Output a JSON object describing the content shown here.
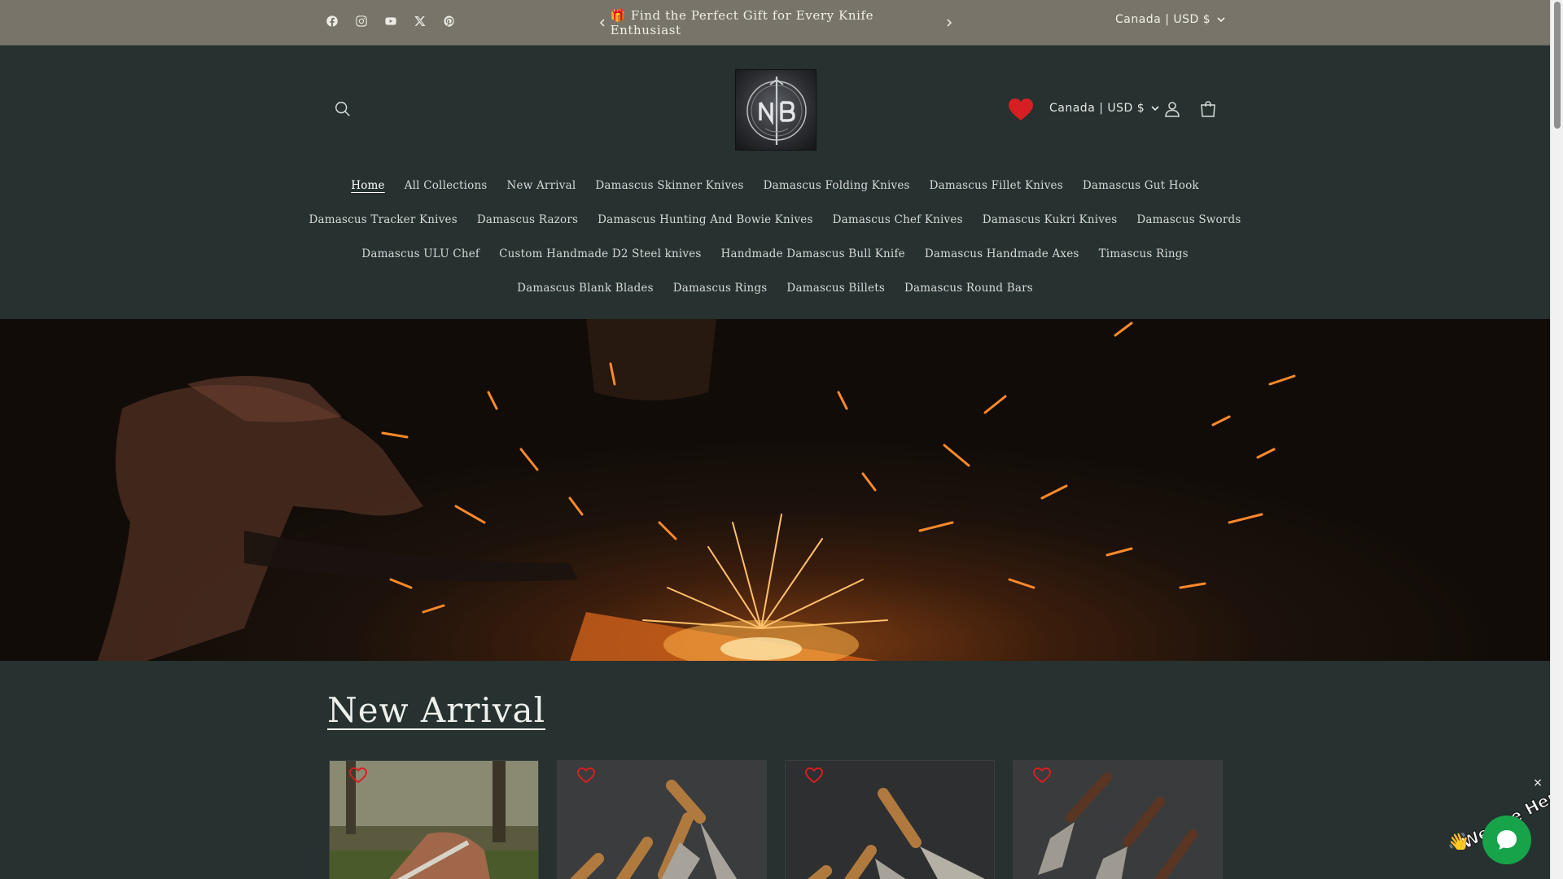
{
  "announcement": {
    "message": "Find the Perfect Gift for Every Knife Enthusiast",
    "gift_icon": "🎁",
    "locale": "Canada | USD $",
    "social_icons": [
      "facebook-icon",
      "instagram-icon",
      "youtube-icon",
      "x-icon",
      "pinterest-icon"
    ]
  },
  "header": {
    "logo_alt": "NB Knives",
    "locale": "Canada | USD $"
  },
  "nav": {
    "rows": [
      [
        "Home",
        "All Collections",
        "New Arrival",
        "Damascus Skinner Knives",
        "Damascus Folding Knives",
        "Damascus Fillet Knives",
        "Damascus Gut Hook"
      ],
      [
        "Damascus Tracker Knives",
        "Damascus Razors",
        "Damascus Hunting And Bowie Knives",
        "Damascus Chef Knives",
        "Damascus Kukri Knives",
        "Damascus Swords"
      ],
      [
        "Damascus ULU Chef",
        "Custom Handmade D2 Steel knives",
        "Handmade Damascus Bull Knife",
        "Damascus Handmade Axes",
        "Timascus Rings"
      ],
      [
        "Damascus Blank Blades",
        "Damascus Rings",
        "Damascus Billets",
        "Damascus Round Bars"
      ]
    ],
    "active": "Home"
  },
  "new_arrival": {
    "title": "New Arrival"
  },
  "chat": {
    "badge_text": "We Are Here!",
    "close": "×"
  },
  "colors": {
    "background": "#263130",
    "announcement_bg": "#78746a",
    "wishlist_red": "#d61f22",
    "chat_green": "#17a34a"
  }
}
